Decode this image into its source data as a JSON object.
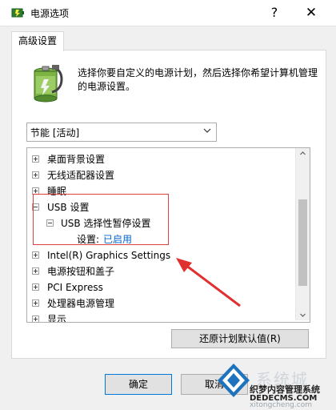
{
  "window": {
    "title": "电源选项",
    "help_glyph": "?",
    "close_glyph": "✕",
    "icon": "power-options-icon"
  },
  "tab": {
    "label": "高级设置"
  },
  "intro": {
    "text": "选择你要自定义的电源计划，然后选择你希望计算机管理的电源设置。",
    "icon": "battery-icon"
  },
  "plan": {
    "selected": "节能 [活动]"
  },
  "tree": {
    "items": [
      {
        "label": "桌面背景设置",
        "expander": "plus"
      },
      {
        "label": "无线适配器设置",
        "expander": "plus"
      },
      {
        "label": "睡眠",
        "expander": "plus"
      },
      {
        "label": "USB 设置",
        "expander": "minus"
      },
      {
        "label": "USB 选择性暂停设置",
        "expander": "minus"
      },
      {
        "label": "设置:",
        "value": "已启用"
      },
      {
        "label": "Intel(R) Graphics Settings",
        "expander": "plus"
      },
      {
        "label": "电源按钮和盖子",
        "expander": "plus"
      },
      {
        "label": "PCI Express",
        "expander": "plus"
      },
      {
        "label": "处理器电源管理",
        "expander": "plus"
      },
      {
        "label": "显示",
        "expander": "plus"
      }
    ]
  },
  "buttons": {
    "restore": "还原计划默认值(R)",
    "ok": "确定",
    "cancel": "取消"
  },
  "annotation": {
    "box_color": "#e04040",
    "arrow_color": "#e03030"
  },
  "watermark": {
    "brand": "系统城",
    "site": "织梦内容管理系统",
    "url": "DEDECMS.COM",
    "site2": "xitongcheng.com"
  }
}
